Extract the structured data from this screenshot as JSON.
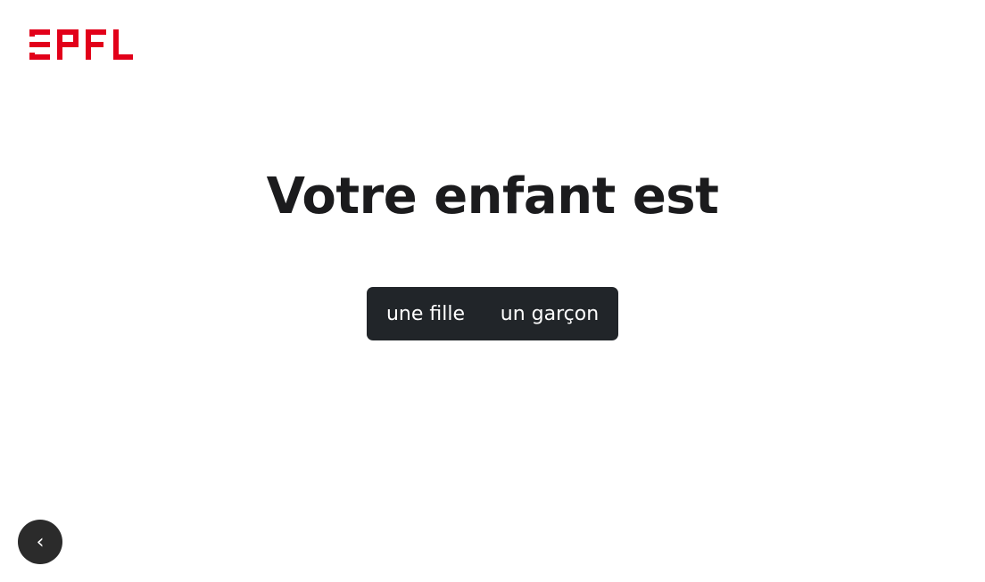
{
  "brand": {
    "logo_text": "EPFL",
    "logo_color": "#e2001a"
  },
  "main": {
    "question": "Votre enfant est",
    "options": [
      {
        "label": "une fille"
      },
      {
        "label": "un garçon"
      }
    ],
    "options_bg": "#212529",
    "options_fg": "#ffffff"
  },
  "nav": {
    "back_icon": "chevron-left-icon",
    "back_glyph": "‹",
    "back_bg": "#2b2b2b"
  }
}
